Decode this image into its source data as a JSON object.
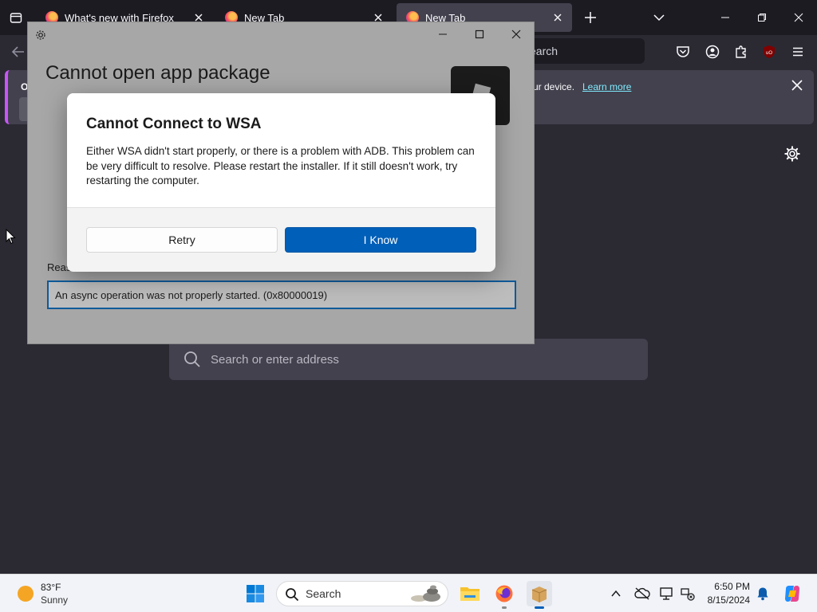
{
  "browser": {
    "tabs": [
      {
        "title": "What's new with Firefox"
      },
      {
        "title": "New Tab"
      },
      {
        "title": "New Tab"
      }
    ],
    "url_placeholder_partial": "earch",
    "notification": {
      "label_partial": "Op",
      "text_partial": "ur device.",
      "link": "Learn more"
    },
    "search_placeholder": "Search or enter address"
  },
  "app_window": {
    "title": "Cannot open app package",
    "reason_label_partial": "Reas",
    "reason_text": "An async operation was not properly started. (0x80000019)"
  },
  "dialog": {
    "title": "Cannot Connect to WSA",
    "message": "Either WSA didn't start properly, or there is a problem with ADB. This problem can be very difficult to resolve. Please restart the installer. If it still doesn't work, try restarting the computer.",
    "retry_label": "Retry",
    "know_label": "I Know"
  },
  "taskbar": {
    "weather": {
      "temp": "83°F",
      "condition": "Sunny"
    },
    "search_label": "Search",
    "clock": {
      "time": "6:50 PM",
      "date": "8/15/2024"
    }
  },
  "colors": {
    "accent": "#005fb8",
    "firefox_tab_bg": "#1c1b22",
    "firefox_content_bg": "#2b2a33",
    "link": "#80ebff"
  }
}
